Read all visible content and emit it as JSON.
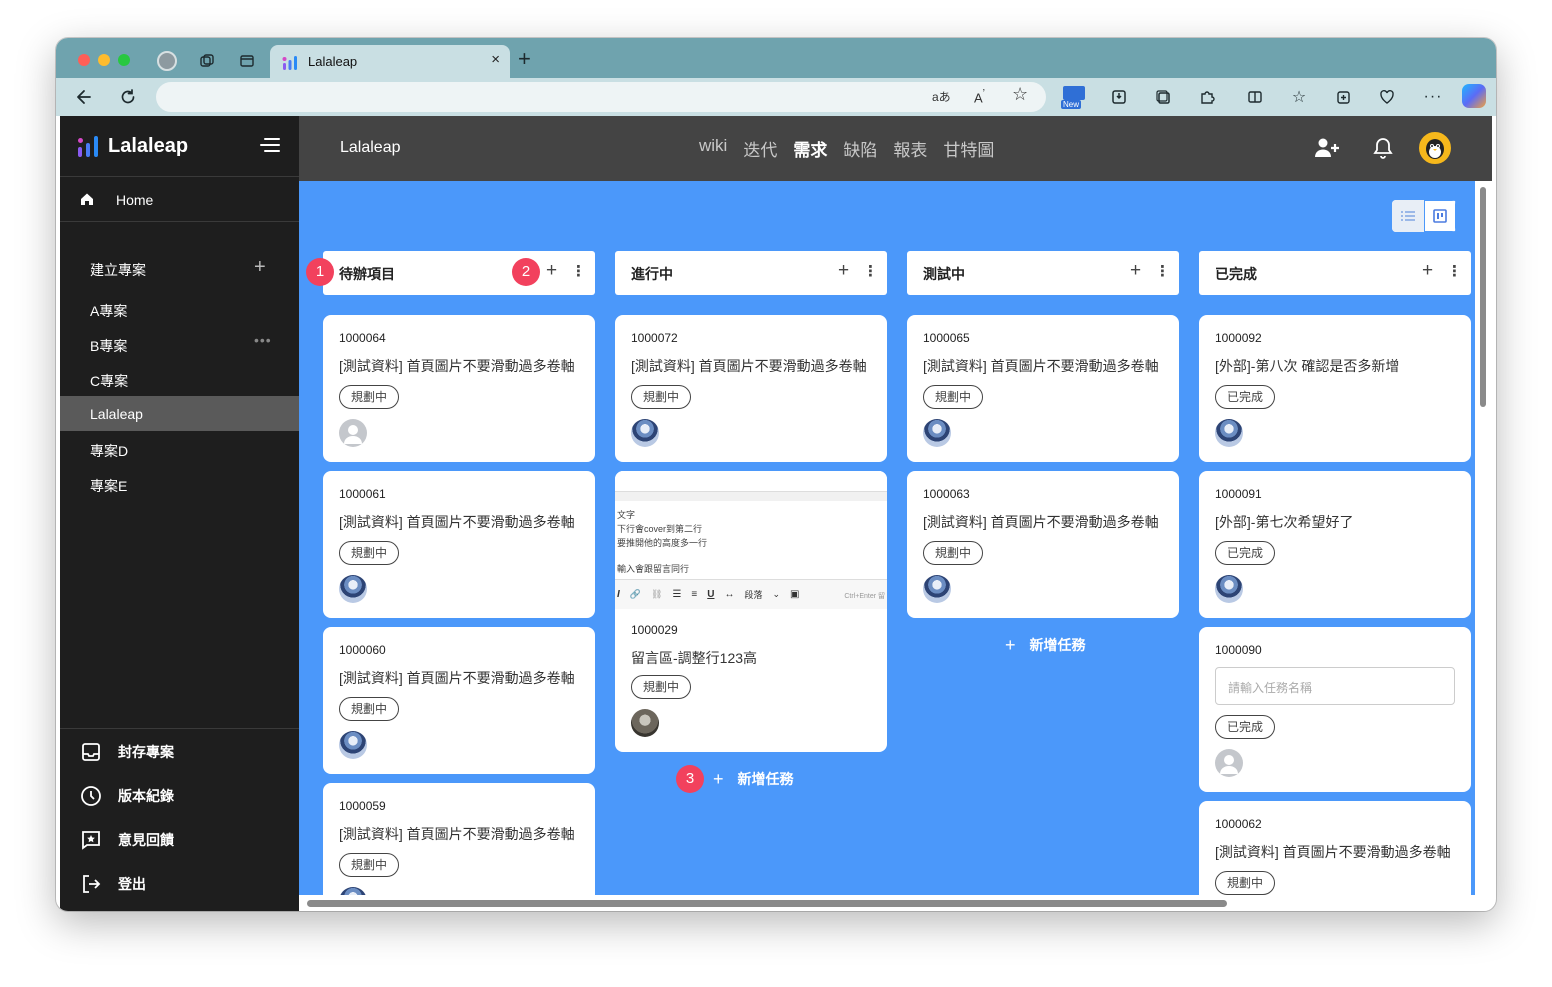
{
  "browser": {
    "tab_title": "Lalaleap",
    "tab_close": "×",
    "new_tab": "+",
    "url": ""
  },
  "sidebar": {
    "brand": "Lalaleap",
    "home": "Home",
    "create_project": "建立專案",
    "projects": [
      {
        "label": "A專案",
        "active": false
      },
      {
        "label": "B專案",
        "active": false,
        "more": "•••"
      },
      {
        "label": "C專案",
        "active": false
      },
      {
        "label": "Lalaleap",
        "active": true
      },
      {
        "label": "專案D",
        "active": false
      },
      {
        "label": "專案E",
        "active": false
      }
    ],
    "bottom": [
      {
        "label": "封存專案",
        "icon": "inbox-icon"
      },
      {
        "label": "版本紀錄",
        "icon": "clock-icon"
      },
      {
        "label": "意見回饋",
        "icon": "feedback-icon"
      },
      {
        "label": "登出",
        "icon": "logout-icon"
      }
    ]
  },
  "topbar": {
    "title": "Lalaleap",
    "nav": [
      {
        "label": "wiki",
        "active": false
      },
      {
        "label": "迭代",
        "active": false
      },
      {
        "label": "需求",
        "active": true
      },
      {
        "label": "缺陷",
        "active": false
      },
      {
        "label": "報表",
        "active": false
      },
      {
        "label": "甘特圖",
        "active": false
      }
    ]
  },
  "board": {
    "columns": [
      {
        "name": "待辦項目",
        "add": "+",
        "more": "⋮"
      },
      {
        "name": "進行中",
        "add": "+",
        "more": "⋮"
      },
      {
        "name": "測試中",
        "add": "+",
        "more": "⋮"
      },
      {
        "name": "已完成",
        "add": "+",
        "more": "⋮"
      }
    ],
    "col1_cards": [
      {
        "id": "1000064",
        "title": "[測試資料] 首頁圖片不要滑動過多卷軸",
        "status": "規劃中",
        "avatar": "grey"
      },
      {
        "id": "1000061",
        "title": "[測試資料] 首頁圖片不要滑動過多卷軸",
        "status": "規劃中",
        "avatar": "anime"
      },
      {
        "id": "1000060",
        "title": "[測試資料] 首頁圖片不要滑動過多卷軸",
        "status": "規劃中",
        "avatar": "anime"
      },
      {
        "id": "1000059",
        "title": "[測試資料] 首頁圖片不要滑動過多卷軸",
        "status": "規劃中",
        "avatar": "anime"
      }
    ],
    "col2_cards": [
      {
        "id": "1000072",
        "title": "[測試資料] 首頁圖片不要滑動過多卷軸",
        "status": "規劃中",
        "avatar": "anime"
      },
      {
        "id": "1000029",
        "title": "留言區-調整行123高",
        "status": "規劃中",
        "avatar": "photo"
      }
    ],
    "col2_editor": {
      "lines": [
        "文字",
        "下行會cover到第二行",
        "要推開他的高度多一行",
        "輸入會跟留言同行"
      ],
      "tools": [
        "I",
        "🔗",
        "⛓",
        "☰",
        "≡",
        "U",
        "↔",
        "段落",
        "⌄",
        "▣"
      ],
      "hint": "Ctrl+Enter 留"
    },
    "col3_cards": [
      {
        "id": "1000065",
        "title": "[測試資料] 首頁圖片不要滑動過多卷軸",
        "status": "規劃中",
        "avatar": "anime"
      },
      {
        "id": "1000063",
        "title": "[測試資料] 首頁圖片不要滑動過多卷軸",
        "status": "規劃中",
        "avatar": "anime"
      }
    ],
    "col4_cards": [
      {
        "id": "1000092",
        "title": "[外部]-第八次 確認是否多新增",
        "status": "已完成",
        "avatar": "anime"
      },
      {
        "id": "1000091",
        "title": "[外部]-第七次希望好了",
        "status": "已完成",
        "avatar": "anime"
      },
      {
        "id": "1000090",
        "input_placeholder": "請輸入任務名稱",
        "status": "已完成",
        "avatar": "grey"
      },
      {
        "id": "1000062",
        "title": "[測試資料] 首頁圖片不要滑動過多卷軸",
        "status": "規劃中"
      }
    ],
    "add_task": "新增任務",
    "markers": [
      "1",
      "2",
      "3"
    ]
  },
  "colors": {
    "board_bg": "#4b98fa",
    "sidebar_bg": "#1e1e1e",
    "topbar_bg": "#444444",
    "marker": "#f2415d",
    "tab_strip": "#6fa3ae"
  }
}
